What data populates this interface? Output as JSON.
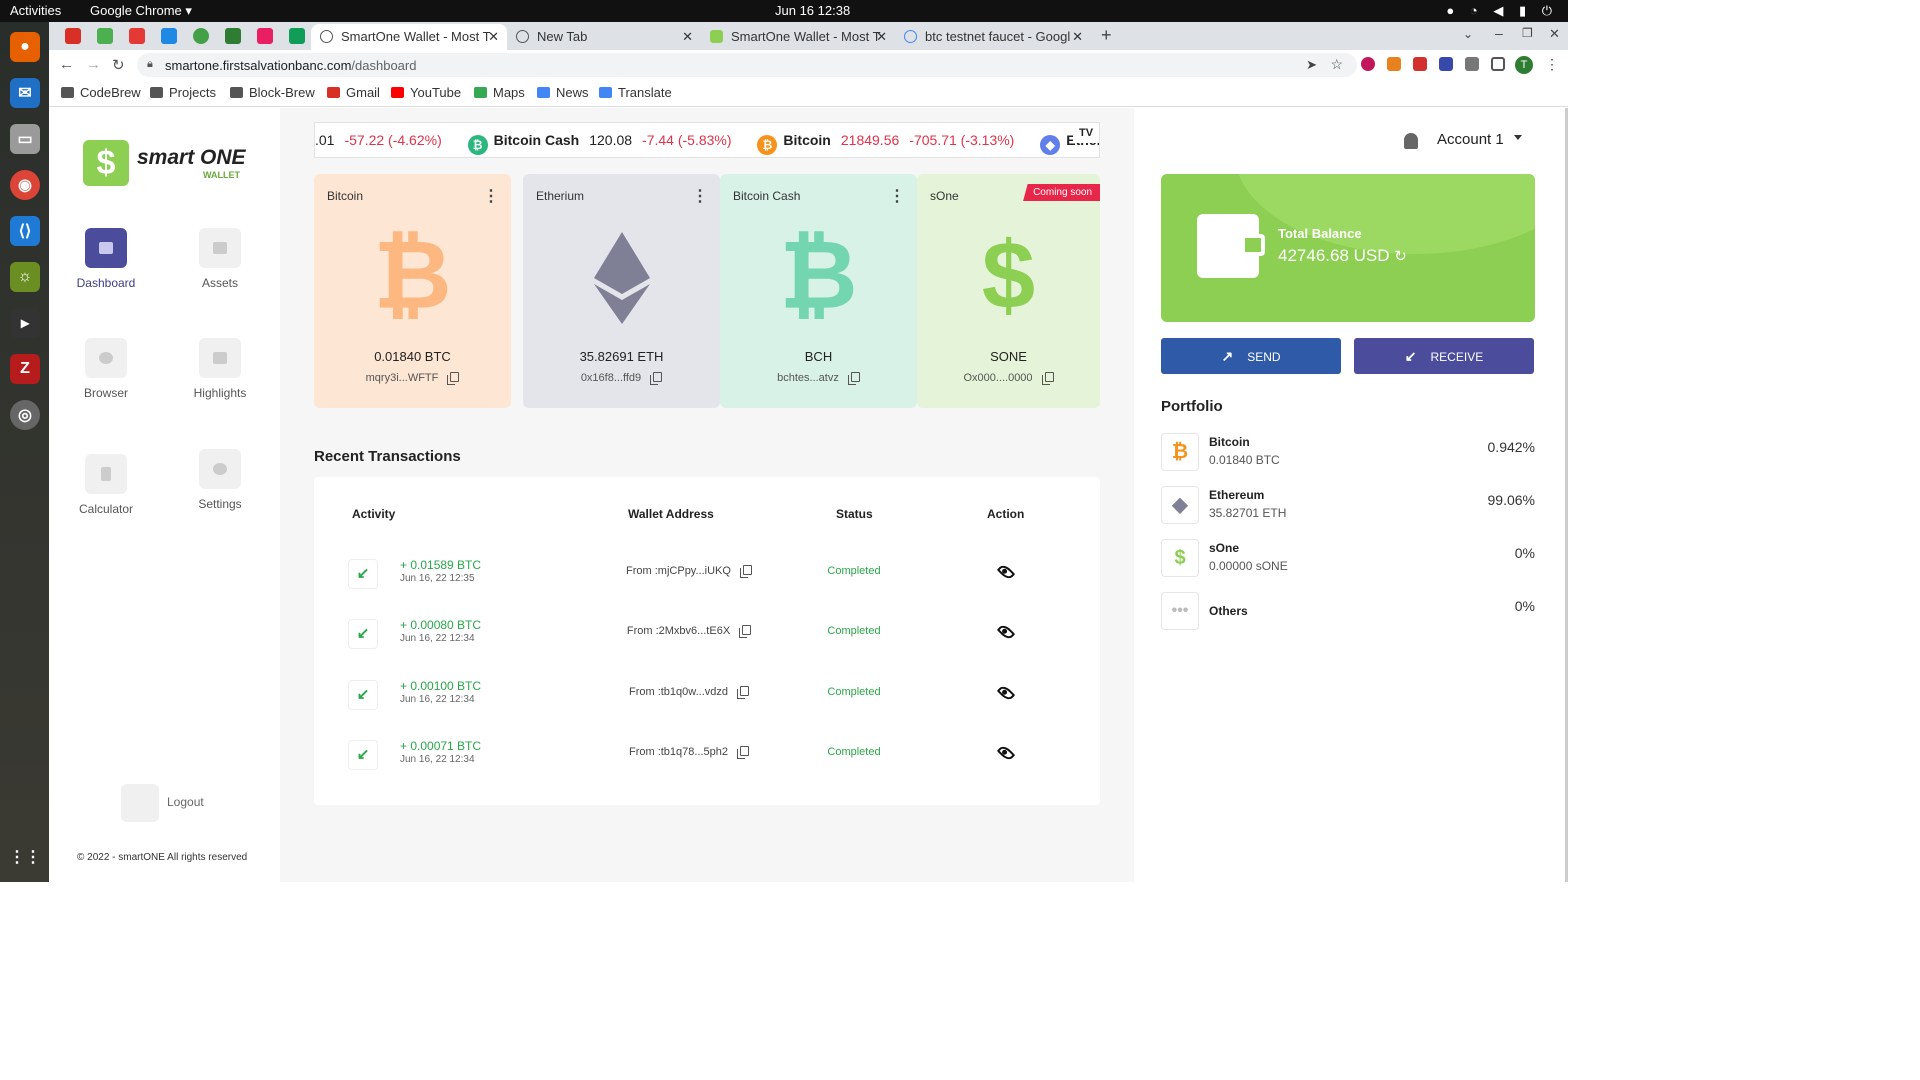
{
  "os": {
    "activities": "Activities",
    "app": "Google Chrome",
    "clock": "Jun 16  12:38"
  },
  "browser": {
    "tabs": [
      {
        "title": "SmartOne Wallet - Most T"
      },
      {
        "title": "New Tab"
      },
      {
        "title": "SmartOne Wallet - Most T"
      },
      {
        "title": "btc testnet faucet - Googl"
      }
    ],
    "url_host": "smartone.firstsalvationbanc.com",
    "url_path": "/dashboard",
    "bookmarks": [
      "CodeBrew",
      "Projects",
      "Block-Brew",
      "Gmail",
      "YouTube",
      "Maps",
      "News",
      "Translate"
    ]
  },
  "sidebar": {
    "logo_name": "smart ONE",
    "logo_sub": "WALLET",
    "nav": [
      "Dashboard",
      "Assets",
      "Browser",
      "Highlights",
      "Calculator",
      "Settings"
    ],
    "logout": "Logout",
    "copyright": "© 2022 - smartONE All rights reserved"
  },
  "ticker": [
    {
      "name": "",
      "price": ".01",
      "change": "-57.22 (-4.62%)"
    },
    {
      "name": "Bitcoin Cash",
      "price": "120.08",
      "change": "-7.44 (-5.83%)"
    },
    {
      "name": "Bitcoin",
      "price": "21849.56",
      "change": "-705.71 (-3.13%)"
    },
    {
      "name": "Ethere",
      "price": "",
      "change": ""
    }
  ],
  "cards": [
    {
      "name": "Bitcoin",
      "amount": "0.01840 BTC",
      "address": "mqry3i...WFTF"
    },
    {
      "name": "Etherium",
      "amount": "35.82691 ETH",
      "address": "0x16f8...ffd9"
    },
    {
      "name": "Bitcoin Cash",
      "amount": "BCH",
      "address": "bchtes...atvz"
    },
    {
      "name": "sOne",
      "amount": "SONE",
      "address": "Ox000....0000",
      "badge": "Coming soon"
    }
  ],
  "transactions": {
    "title": "Recent Transactions",
    "headers": [
      "Activity",
      "Wallet Address",
      "Status",
      "Action"
    ],
    "rows": [
      {
        "amount": "+ 0.01589 BTC",
        "date": "Jun 16, 22 12:35",
        "address": "From :mjCPpy...iUKQ",
        "status": "Completed"
      },
      {
        "amount": "+ 0.00080 BTC",
        "date": "Jun 16, 22 12:34",
        "address": "From :2Mxbv6...tE6X",
        "status": "Completed"
      },
      {
        "amount": "+ 0.00100 BTC",
        "date": "Jun 16, 22 12:34",
        "address": "From :tb1q0w...vdzd",
        "status": "Completed"
      },
      {
        "amount": "+ 0.00071 BTC",
        "date": "Jun 16, 22 12:34",
        "address": "From :tb1q78...5ph2",
        "status": "Completed"
      }
    ]
  },
  "account": {
    "label": "Account 1"
  },
  "balance": {
    "label": "Total Balance",
    "value": "42746.68  USD"
  },
  "actions": {
    "send": "SEND",
    "receive": "RECEIVE"
  },
  "portfolio": {
    "title": "Portfolio",
    "items": [
      {
        "name": "Bitcoin",
        "amount": "0.01840 BTC",
        "percent": "0.942%"
      },
      {
        "name": "Ethereum",
        "amount": "35.82701 ETH",
        "percent": "99.06%"
      },
      {
        "name": "sOne",
        "amount": "0.00000 sONE",
        "percent": "0%"
      },
      {
        "name": "Others",
        "amount": "",
        "percent": "0%"
      }
    ]
  },
  "colors": {
    "green": "#8ccf52",
    "send": "#2f5aa8",
    "receive": "#4b4c9b",
    "negative": "#e0324a",
    "completed": "#2aa74a"
  }
}
